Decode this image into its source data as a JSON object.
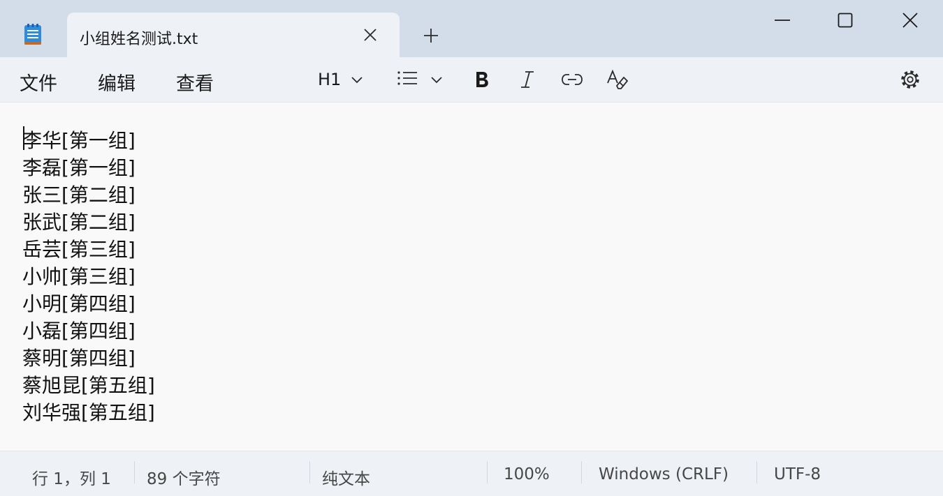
{
  "window": {
    "tab_title": "小组姓名测试.txt",
    "icons": {
      "app": "notepad-icon",
      "tab_close": "close-icon",
      "new_tab": "plus-icon",
      "minimize": "minimize-icon",
      "maximize": "maximize-icon",
      "close": "close-icon"
    }
  },
  "menu": {
    "file": "文件",
    "edit": "编辑",
    "view": "查看"
  },
  "toolbar": {
    "heading_label": "H1",
    "icons": {
      "heading_dropdown": "chevron-down-icon",
      "list": "bulleted-list-icon",
      "list_dropdown": "chevron-down-icon",
      "bold": "bold-icon",
      "italic": "italic-icon",
      "link": "link-icon",
      "clear_format": "clear-formatting-icon",
      "settings": "gear-icon"
    }
  },
  "editor": {
    "lines": [
      "李华[第一组]",
      "李磊[第一组]",
      "张三[第二组]",
      "张武[第二组]",
      "岳芸[第三组]",
      "小帅[第三组]",
      "小明[第四组]",
      "小磊[第四组]",
      "蔡明[第四组]",
      "蔡旭昆[第五组]",
      "刘华强[第五组]"
    ]
  },
  "status": {
    "position": "行 1，列 1",
    "char_count": "89 个字符",
    "format": "纯文本",
    "zoom": "100%",
    "line_ending": "Windows (CRLF)",
    "encoding": "UTF-8"
  },
  "colors": {
    "titlebar": "#d3ddea",
    "menubar": "#eef1f5",
    "editor_bg": "#f9f9f9",
    "accent": "#1f6fd1"
  }
}
